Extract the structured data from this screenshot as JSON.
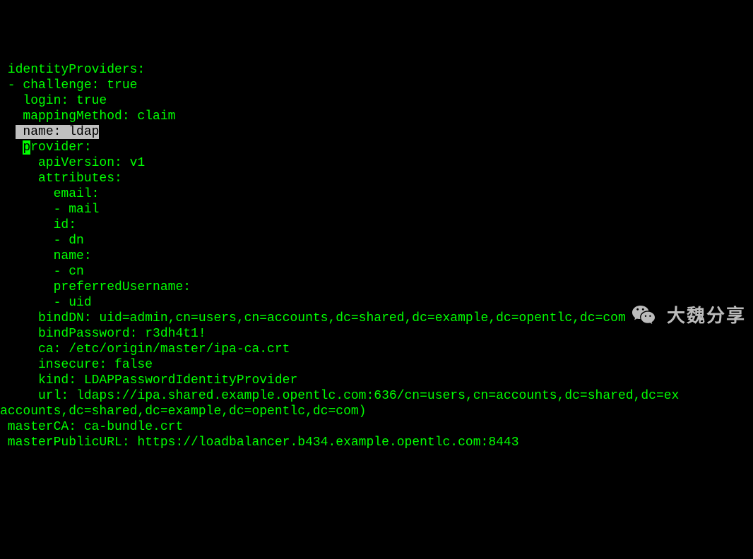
{
  "terminal": {
    "lines": [
      {
        "indent": " ",
        "text": "identityProviders:"
      },
      {
        "indent": " ",
        "text": "- challenge: true"
      },
      {
        "indent": "   ",
        "text": "login: true"
      },
      {
        "indent": "   ",
        "text": "mappingMethod: claim"
      },
      {
        "indent": "   ",
        "text": "name: ldap",
        "highlight": true
      },
      {
        "indent": "   ",
        "text": "provider:",
        "cursor_at": 0
      },
      {
        "indent": "     ",
        "text": "apiVersion: v1"
      },
      {
        "indent": "     ",
        "text": "attributes:"
      },
      {
        "indent": "       ",
        "text": "email:"
      },
      {
        "indent": "       ",
        "text": "- mail"
      },
      {
        "indent": "       ",
        "text": "id:"
      },
      {
        "indent": "       ",
        "text": "- dn"
      },
      {
        "indent": "       ",
        "text": "name:"
      },
      {
        "indent": "       ",
        "text": "- cn"
      },
      {
        "indent": "       ",
        "text": "preferredUsername:"
      },
      {
        "indent": "       ",
        "text": "- uid"
      },
      {
        "indent": "     ",
        "text": "bindDN: uid=admin,cn=users,cn=accounts,dc=shared,dc=example,dc=opentlc,dc=com"
      },
      {
        "indent": "     ",
        "text": "bindPassword: r3dh4t1!"
      },
      {
        "indent": "     ",
        "text": "ca: /etc/origin/master/ipa-ca.crt"
      },
      {
        "indent": "     ",
        "text": "insecure: false"
      },
      {
        "indent": "     ",
        "text": "kind: LDAPPasswordIdentityProvider"
      },
      {
        "indent": "     ",
        "text": "url: ldaps://ipa.shared.example.opentlc.com:636/cn=users,cn=accounts,dc=shared,dc=ex"
      },
      {
        "indent": "",
        "text": "accounts,dc=shared,dc=example,dc=opentlc,dc=com)"
      },
      {
        "indent": " ",
        "text": "masterCA: ca-bundle.crt"
      },
      {
        "indent": " ",
        "text": "masterPublicURL: https://loadbalancer.b434.example.opentlc.com:8443"
      }
    ]
  },
  "watermark": {
    "text": "大魏分享",
    "icon": "wechat-icon"
  }
}
